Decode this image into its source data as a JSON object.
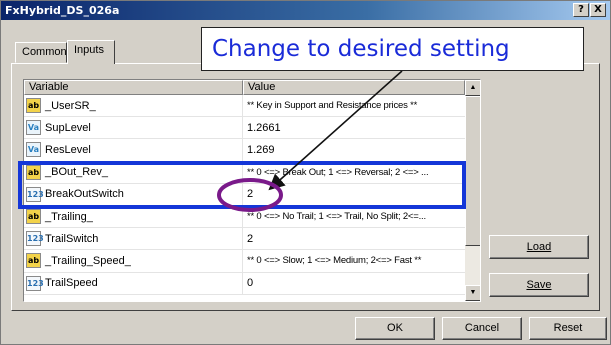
{
  "window": {
    "title": "FxHybrid_DS_026a"
  },
  "titlebar": {
    "help_label": "?",
    "close_label": "X"
  },
  "tabs": [
    {
      "label": "Common",
      "active": false
    },
    {
      "label": "Inputs",
      "active": true
    }
  ],
  "grid": {
    "columns": [
      "Variable",
      "Value"
    ],
    "rows": [
      {
        "icon": "ab",
        "name": "_UserSR_",
        "value": "** Key in Support and Resistance prices **",
        "comment": true
      },
      {
        "icon": "Va",
        "name": "SupLevel",
        "value": "1.2661",
        "comment": false
      },
      {
        "icon": "Va",
        "name": "ResLevel",
        "value": "1.269",
        "comment": false
      },
      {
        "icon": "ab",
        "name": "_BOut_Rev_",
        "value": "** 0 <=> Break Out; 1 <=> Reversal; 2 <=> ...",
        "comment": true
      },
      {
        "icon": "123",
        "name": "BreakOutSwitch",
        "value": "2",
        "comment": false
      },
      {
        "icon": "ab",
        "name": "_Trailing_",
        "value": "** 0 <=> No Trail; 1 <=> Trail, No Split; 2<=...",
        "comment": true
      },
      {
        "icon": "123",
        "name": "TrailSwitch",
        "value": "2",
        "comment": false
      },
      {
        "icon": "ab",
        "name": "_Trailing_Speed_",
        "value": "** 0 <=> Slow; 1 <=> Medium; 2<=> Fast **",
        "comment": true
      },
      {
        "icon": "123",
        "name": "TrailSpeed",
        "value": "0",
        "comment": false
      }
    ]
  },
  "buttons": {
    "load": "Load",
    "save": "Save",
    "ok": "OK",
    "cancel": "Cancel",
    "reset": "Reset"
  },
  "annotation": {
    "callout_text": "Change to desired setting",
    "highlight_color": "#1436d8",
    "circle_color": "#7a1a8a",
    "text_color": "#1a2bd8"
  }
}
